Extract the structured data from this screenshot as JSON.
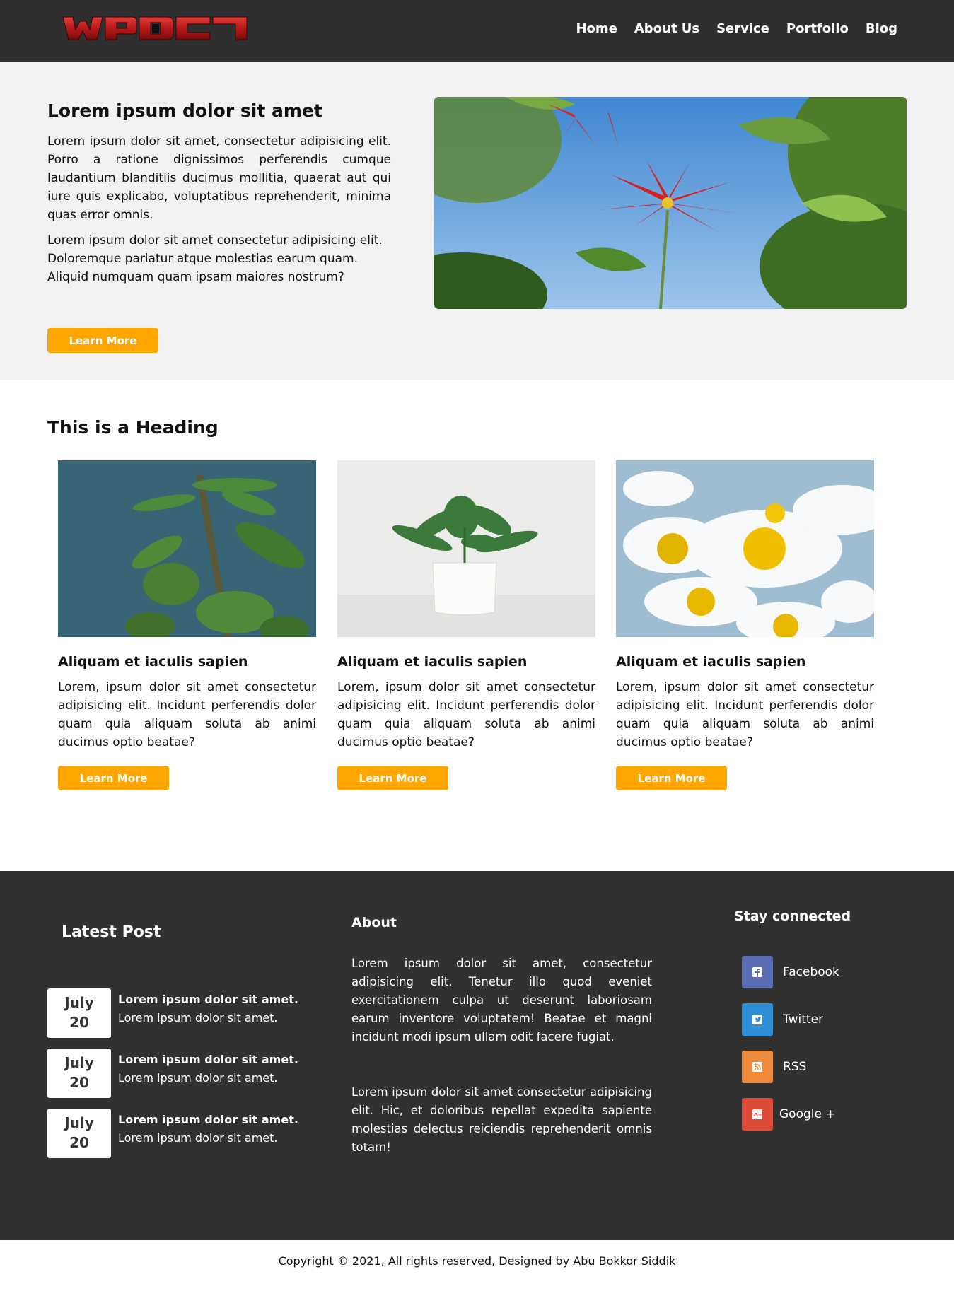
{
  "header": {
    "logo_text": "WPDC1",
    "nav": [
      "Home",
      "About Us",
      "Service",
      "Portfolio",
      "Blog"
    ]
  },
  "hero": {
    "title": "Lorem ipsum dolor sit amet",
    "paragraph1": "Lorem ipsum dolor sit amet, consectetur adipisicing elit. Porro a ratione dignissimos perferendis cumque laudantium blanditiis ducimus mollitia, quaerat aut qui iure quis explicabo, voluptatibus reprehenderit, minima quas error omnis.",
    "paragraph2": "Lorem ipsum dolor sit amet consectetur adipisicing elit. Doloremque pariatur atque molestias earum quam. Aliquid numquam quam ipsam maiores nostrum?",
    "button": "Learn More"
  },
  "section": {
    "heading": "This is a Heading",
    "cards": [
      {
        "title": "Aliquam et iaculis sapien",
        "text": "Lorem, ipsum dolor sit amet consectetur adipisicing elit. Incidunt perferendis dolor quam quia aliquam soluta ab animi ducimus optio beatae?",
        "button": "Learn More"
      },
      {
        "title": "Aliquam et iaculis sapien",
        "text": "Lorem, ipsum dolor sit amet consectetur adipisicing elit. Incidunt perferendis dolor quam quia aliquam soluta ab animi ducimus optio beatae?",
        "button": "Learn More"
      },
      {
        "title": "Aliquam et iaculis sapien",
        "text": "Lorem, ipsum dolor sit amet consectetur adipisicing elit. Incidunt perferendis dolor quam quia aliquam soluta ab animi ducimus optio beatae?",
        "button": "Learn More"
      }
    ]
  },
  "footer": {
    "latest_title": "Latest Post",
    "posts": [
      {
        "month": "July",
        "day": "20",
        "title": "Lorem ipsum dolor sit amet.",
        "sub": "Lorem ipsum dolor sit amet."
      },
      {
        "month": "July",
        "day": "20",
        "title": "Lorem ipsum dolor sit amet.",
        "sub": "Lorem ipsum dolor sit amet."
      },
      {
        "month": "July",
        "day": "20",
        "title": "Lorem ipsum dolor sit amet.",
        "sub": "Lorem ipsum dolor sit amet."
      }
    ],
    "about_title": "About",
    "about_p1": "Lorem ipsum dolor sit amet, consectetur adipisicing elit. Tenetur illo quod eveniet exercitationem culpa ut deserunt laboriosam earum inventore voluptatem! Beatae et magni incidunt modi ipsum ullam odit facere fugiat.",
    "about_p2": "Lorem ipsum dolor sit amet consectetur adipisicing elit. Hic, et doloribus repellat expedita sapiente molestias delectus reiciendis reprehenderit omnis totam!",
    "stay_title": "Stay connected",
    "social": [
      {
        "label": "Facebook",
        "icon": "facebook-icon",
        "color": "#5a6eb3"
      },
      {
        "label": "Twitter",
        "icon": "twitter-icon",
        "color": "#2f8fd6"
      },
      {
        "label": "RSS",
        "icon": "rss-icon",
        "color": "#ef8b3c"
      },
      {
        "label": "Google +",
        "icon": "google-plus-icon",
        "color": "#dd4b39"
      }
    ]
  },
  "copyright": "Copyright © 2021, All rights reserved, Designed by Abu Bokkor Siddik",
  "colors": {
    "header_bg": "#2f2f2f",
    "hero_bg": "#f1f1f1",
    "accent": "#ffa500",
    "footer_bg": "#313131"
  }
}
